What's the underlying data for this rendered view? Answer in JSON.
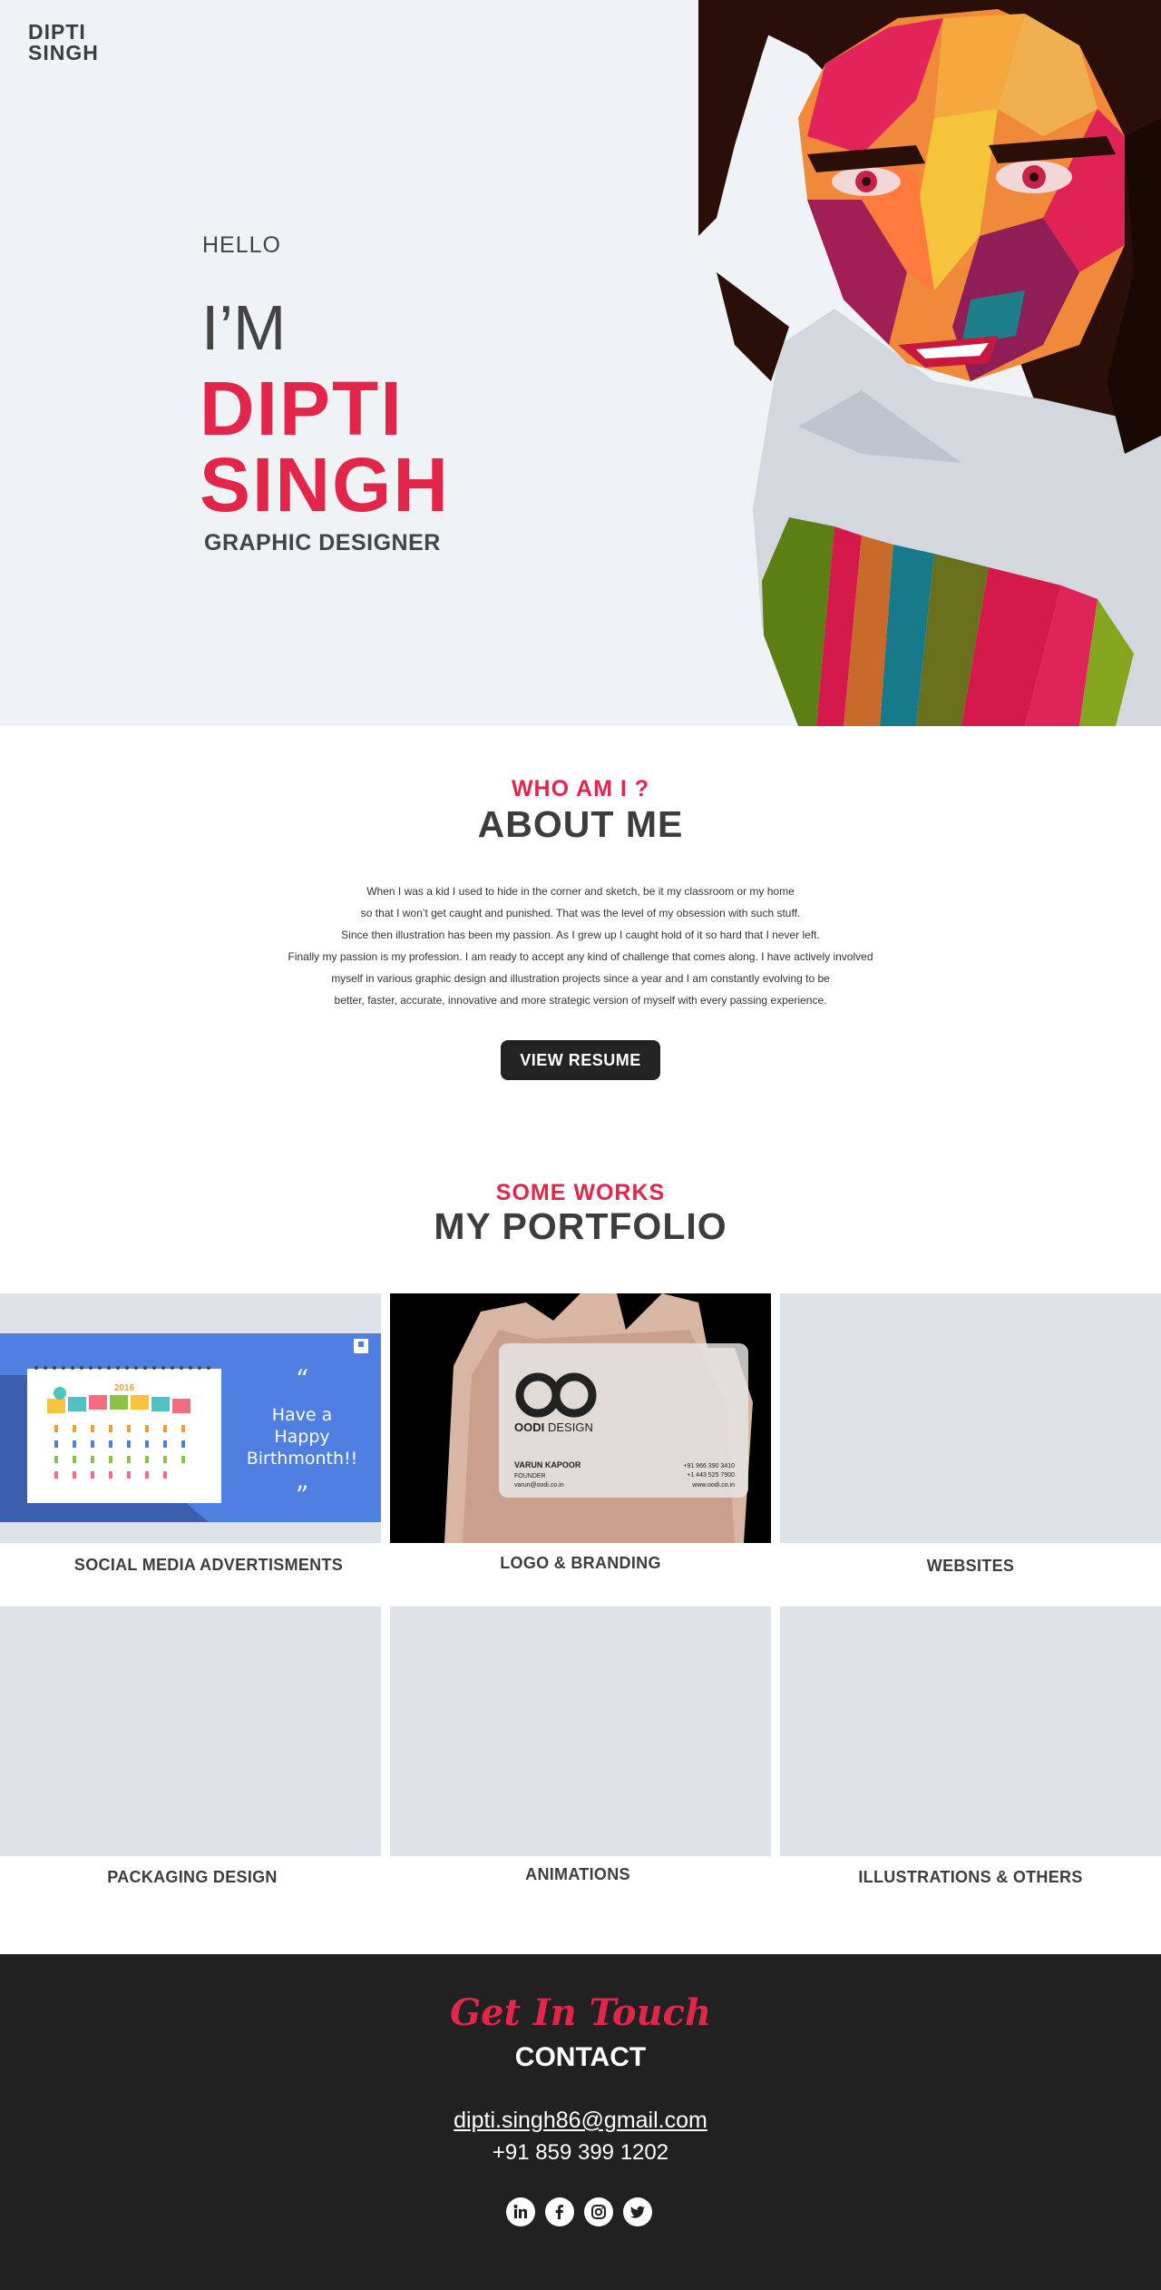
{
  "header": {
    "logo_line1": "DIPTI",
    "logo_line2": "SINGH"
  },
  "hero": {
    "greeting": "HELLO",
    "im": "I’M",
    "first_name": "DIPTI",
    "last_name": "SINGH",
    "role": "GRAPHIC DESIGNER"
  },
  "about": {
    "kicker": "WHO AM I ?",
    "title": "ABOUT ME",
    "paragraph_lines": [
      "When I was a kid I used to hide in the corner and sketch, be it my classroom or my home",
      "so that I won’t get caught and punished. That was the level of my obsession with such stuff.",
      "Since then illustration has been my passion. As I grew up I caught hold of it so hard that I never left.",
      "Finally my passion is my profession. I am ready to accept any kind of challenge that comes along. I have actively involved",
      "myself in various graphic design and illustration projects since a year and I am constantly evolving to be",
      "better, faster, accurate, innovative and more strategic version of myself with every passing experience."
    ],
    "resume_button": "VIEW RESUME"
  },
  "portfolio": {
    "kicker": "SOME WORKS",
    "title": "MY PORTFOLIO",
    "items": [
      {
        "label": "SOCIAL MEDIA ADVERTISMENTS"
      },
      {
        "label": "LOGO & BRANDING"
      },
      {
        "label": "WEBSITES"
      },
      {
        "label": "PACKAGING DESIGN"
      },
      {
        "label": "ANIMATIONS"
      },
      {
        "label": "ILLUSTRATIONS & OTHERS"
      }
    ],
    "social_card": {
      "year": "2016",
      "quote_line1": "Have a",
      "quote_line2": "Happy",
      "quote_line3": "Birthmonth!!",
      "banner_letters": [
        "J",
        "A",
        "N",
        "U",
        "A",
        "R",
        "Y"
      ]
    },
    "business_card": {
      "brand_bold": "OODI",
      "brand_light": "DESIGN",
      "person": "VARUN KAPOOR",
      "title": "FOUNDER",
      "email": "varun@oodi.co.in",
      "phone1": "+91 966 390 3410",
      "phone2": "+1 443 525 7900",
      "web": "www.oodi.co.in"
    }
  },
  "footer": {
    "script_title": "Get In Touch",
    "title": "CONTACT",
    "email": "dipti.singh86@gmail.com",
    "phone": "+91 859 399 1202",
    "social": [
      "linkedin-icon",
      "facebook-icon",
      "instagram-icon",
      "twitter-icon"
    ]
  },
  "colors": {
    "accent": "#e2264a",
    "dark": "#212121",
    "hero_bg": "#eff3f6",
    "tile_bg": "#dee3e9",
    "card_blue": "#4f7fe0"
  }
}
